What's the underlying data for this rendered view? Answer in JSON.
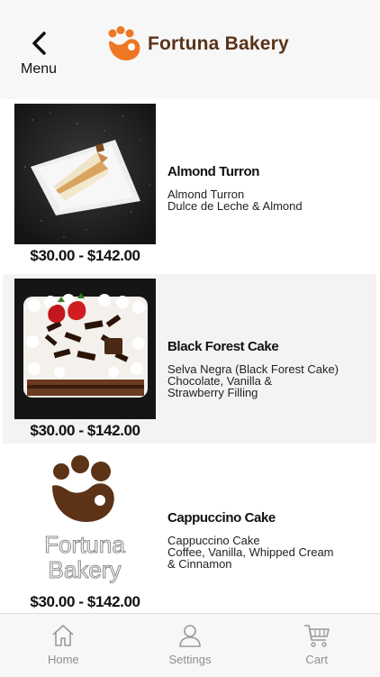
{
  "header": {
    "back_label": "Menu",
    "brand_name": "Fortuna Bakery"
  },
  "items": [
    {
      "title": "Almond Turron",
      "description": "Almond Turron\n Dulce de Leche & Almond",
      "price": "$30.00 - $142.00",
      "image": "cake-slice-photo"
    },
    {
      "title": "Black Forest Cake",
      "description": "Selva Negra (Black Forest Cake)\nChocolate, Vanilla &\nStrawberry Filling",
      "price": "$30.00 - $142.00",
      "image": "black-forest-cake-photo"
    },
    {
      "title": "Cappuccino Cake",
      "description": "Cappuccino Cake\nCoffee, Vanilla, Whipped Cream\n& Cinnamon",
      "price": "$30.00 - $142.00",
      "image": "fortuna-bakery-logo-placeholder",
      "placeholder_text": "Fortuna Bakery"
    }
  ],
  "bottom_nav": [
    {
      "label": "Home",
      "icon": "home-icon"
    },
    {
      "label": "Settings",
      "icon": "user-icon"
    },
    {
      "label": "Cart",
      "icon": "cart-icon"
    }
  ],
  "colors": {
    "brand_orange": "#ee7724",
    "brand_brown": "#5a3318",
    "nav_gray": "#9a9a9a"
  }
}
